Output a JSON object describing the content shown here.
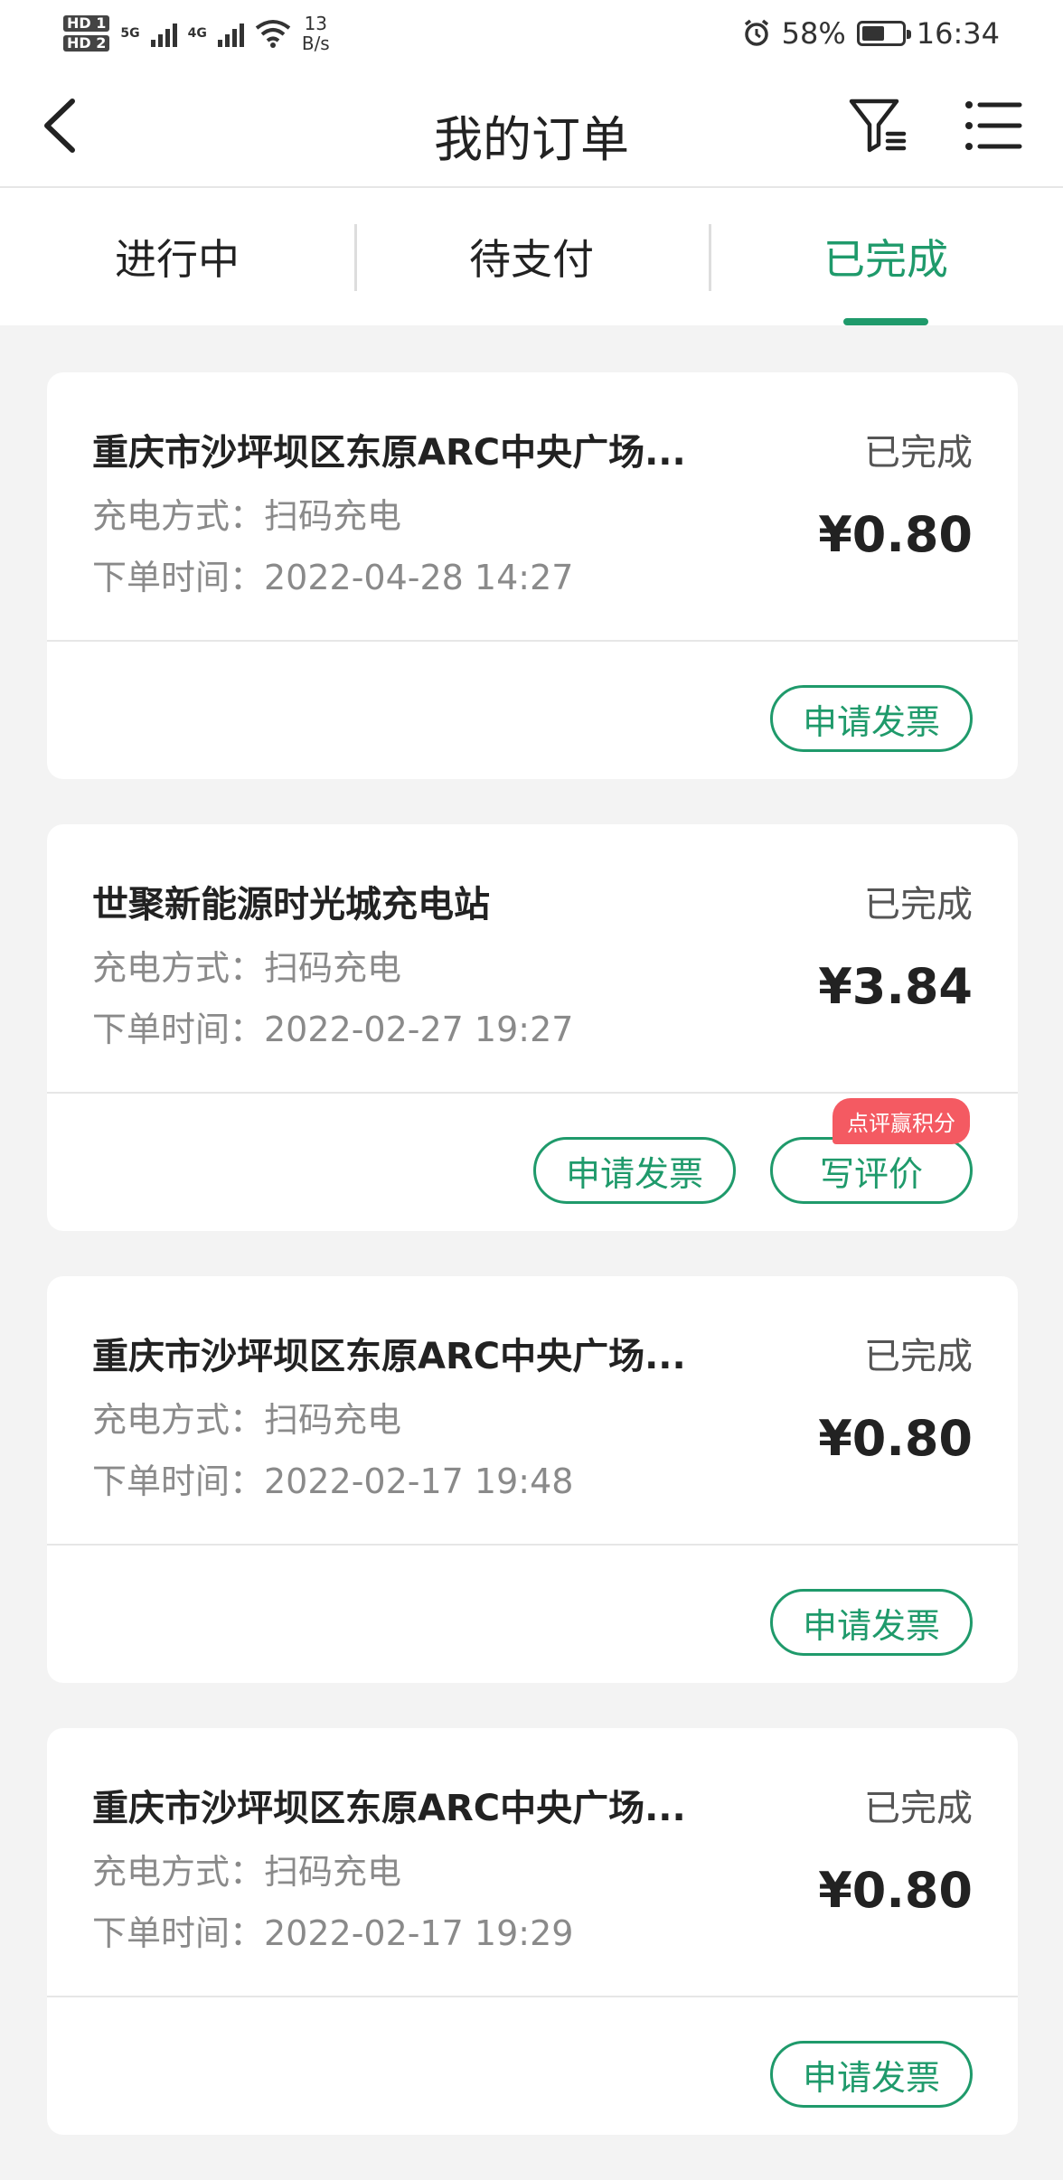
{
  "status_bar": {
    "hd1": "HD 1",
    "hd2": "HD 2",
    "net1": "5G",
    "net2": "4G",
    "speed_value": "13",
    "speed_unit": "B/s",
    "battery_percent": "58%",
    "time": "16:34",
    "icons": [
      "signal-icon",
      "wifi-icon",
      "alarm-icon",
      "battery-icon"
    ]
  },
  "nav": {
    "title": "我的订单",
    "icons": [
      "back-icon",
      "filter-icon",
      "menu-list-icon"
    ]
  },
  "tabs": [
    {
      "label": "进行中"
    },
    {
      "label": "待支付"
    },
    {
      "label": "已完成"
    }
  ],
  "active_tab": "已完成",
  "orders": [
    {
      "station": "重庆市沙坪坝区东原ARC中央广场...",
      "method": "充电方式：扫码充电",
      "time": "下单时间：2022-04-28 14:27",
      "status": "已完成",
      "price": "¥0.80",
      "invoice_label": "申请发票"
    },
    {
      "station": "世聚新能源时光城充电站",
      "method": "充电方式：扫码充电",
      "time": "下单时间：2022-02-27 19:27",
      "status": "已完成",
      "price": "¥3.84",
      "invoice_label": "申请发票",
      "review_label": "写评价",
      "review_badge": "点评赢积分"
    },
    {
      "station": "重庆市沙坪坝区东原ARC中央广场...",
      "method": "充电方式：扫码充电",
      "time": "下单时间：2022-02-17 19:48",
      "status": "已完成",
      "price": "¥0.80",
      "invoice_label": "申请发票"
    },
    {
      "station": "重庆市沙坪坝区东原ARC中央广场...",
      "method": "充电方式：扫码充电",
      "time": "下单时间：2022-02-17 19:29",
      "status": "已完成",
      "price": "¥0.80",
      "invoice_label": "申请发票"
    }
  ],
  "colors": {
    "accent": "#1f9a6b",
    "badge": "#f45a62",
    "background": "#f3f3f3"
  }
}
